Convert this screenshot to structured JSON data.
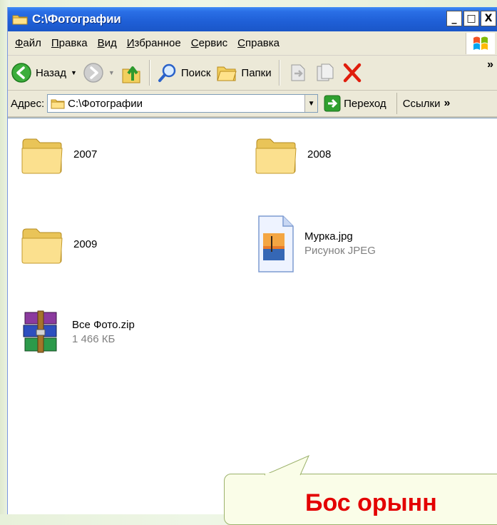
{
  "window": {
    "title": "C:\\Фотографии",
    "buttons": [
      "_",
      "□",
      "X"
    ]
  },
  "menu": [
    "Файл",
    "Правка",
    "Вид",
    "Избранное",
    "Сервис",
    "Справка"
  ],
  "toolbar": {
    "back": "Назад",
    "search": "Поиск",
    "folders": "Папки",
    "more": "»"
  },
  "address": {
    "label": "Адрес:",
    "value": "C:\\Фотографии",
    "go": "Переход",
    "links": "Ссылки",
    "more": "»"
  },
  "items": [
    {
      "name": "2007",
      "type": "folder"
    },
    {
      "name": "2008",
      "type": "folder"
    },
    {
      "name": "2009",
      "type": "folder"
    },
    {
      "name": "Мурка.jpg",
      "sub": "Рисунок JPEG",
      "type": "image"
    },
    {
      "name": "Все Фото.zip",
      "sub": "1 466 КБ",
      "type": "archive"
    }
  ],
  "callout": {
    "text": "Бос орынн"
  },
  "colors": {
    "titlebar": "#1f5fd6",
    "callout_text": "#e30000",
    "folder": "#f5d77a"
  }
}
